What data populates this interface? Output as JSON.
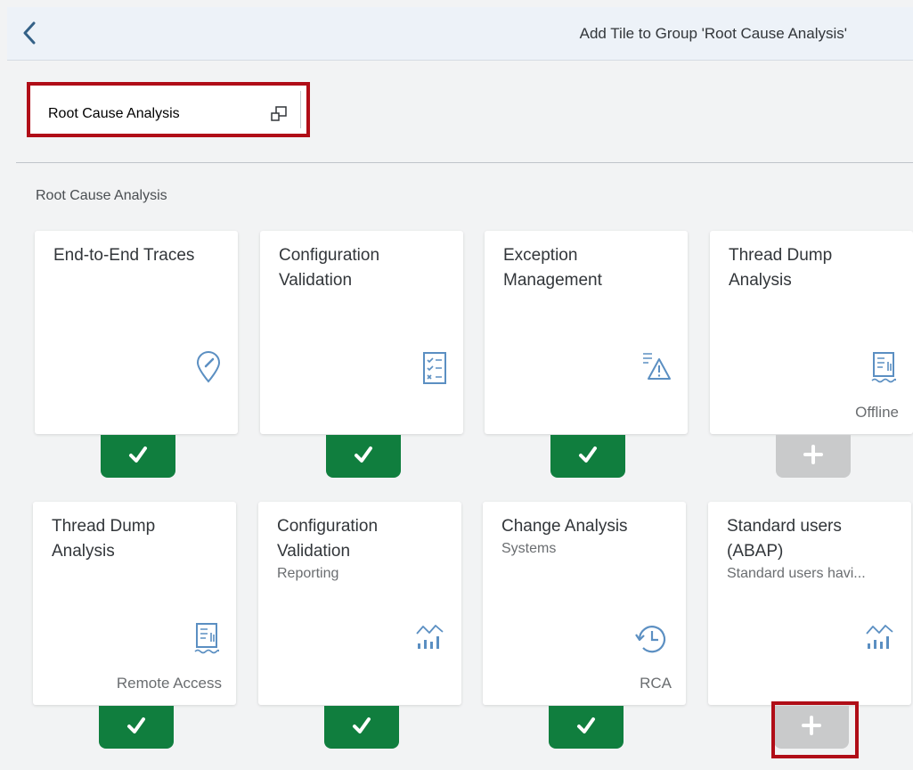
{
  "header": {
    "title": "Add Tile to Group 'Root Cause Analysis'"
  },
  "group_select": {
    "label": "Root Cause Analysis"
  },
  "section": {
    "title": "Root Cause Analysis"
  },
  "colors": {
    "added": "#107e3e",
    "not_added": "#c9cacb",
    "highlight": "#b00d17",
    "icon": "#5b8fc2"
  },
  "tiles": [
    {
      "title": "End-to-End Traces",
      "subtitle": "",
      "footer": "",
      "icon": "compass-pin-icon",
      "added": true
    },
    {
      "title": "Configuration Validation",
      "subtitle": "",
      "footer": "",
      "icon": "checklist-icon",
      "added": true
    },
    {
      "title": "Exception Management",
      "subtitle": "",
      "footer": "",
      "icon": "warning-list-icon",
      "added": true
    },
    {
      "title": "Thread Dump Analysis",
      "subtitle": "",
      "footer": "Offline",
      "icon": "receipt-icon",
      "added": false
    },
    {
      "title": "Thread Dump Analysis",
      "subtitle": "",
      "footer": "Remote Access",
      "icon": "receipt-icon",
      "added": true
    },
    {
      "title": "Configuration Validation",
      "subtitle": "Reporting",
      "footer": "",
      "icon": "line-bar-chart-icon",
      "added": true
    },
    {
      "title": "Change Analysis",
      "subtitle": "Systems",
      "footer": "RCA",
      "icon": "history-icon",
      "added": true
    },
    {
      "title": "Standard users (ABAP)",
      "subtitle": "Standard users havi...",
      "footer": "",
      "icon": "line-bar-chart-icon",
      "added": false
    }
  ]
}
